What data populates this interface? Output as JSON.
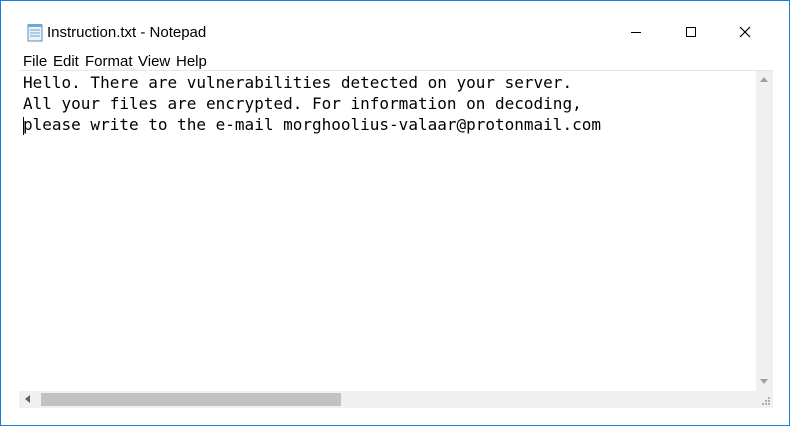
{
  "window": {
    "title": "Instruction.txt - Notepad",
    "icon": "notepad-icon",
    "controls": [
      "minimize-icon",
      "maximize-icon",
      "close-icon"
    ]
  },
  "menu": {
    "items": [
      {
        "label": "File"
      },
      {
        "label": "Edit"
      },
      {
        "label": "Format"
      },
      {
        "label": "View"
      },
      {
        "label": "Help"
      }
    ]
  },
  "editor": {
    "lines": [
      "Hello. There are vulnerabilities detected on your server.",
      "All your files are encrypted. For information on decoding,",
      "please write to the e-mail morghoolius-valaar@protonmail.com"
    ]
  },
  "colors": {
    "border": "#1a7dd7",
    "scrollbar": "#f0f0f0",
    "thumb": "#c2c2c2",
    "watermark": "#f2f2f2"
  }
}
